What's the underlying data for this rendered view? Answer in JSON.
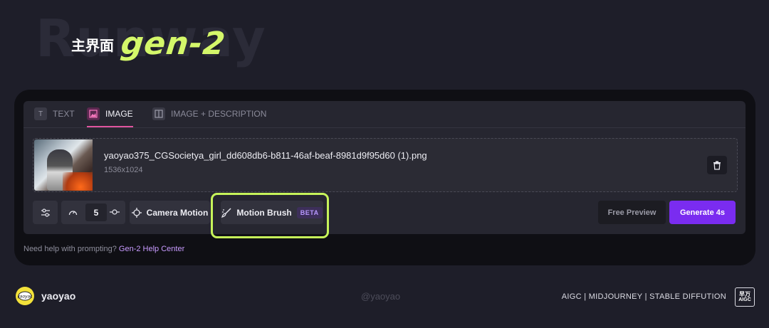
{
  "header": {
    "watermark": "Runway",
    "title_cn": "主界面",
    "title_gen": "gen-2"
  },
  "tabs": [
    {
      "label": "TEXT",
      "icon": "text-icon",
      "active": false
    },
    {
      "label": "IMAGE",
      "icon": "image-icon",
      "active": true
    },
    {
      "label": "IMAGE + DESCRIPTION",
      "icon": "image-description-icon",
      "active": false
    }
  ],
  "file": {
    "name": "yaoyao375_CGSocietya_girl_dd608db6-b811-46af-beaf-8981d9f95d60 (1).png",
    "dimensions": "1536x1024"
  },
  "toolbar": {
    "speed_value": "5",
    "camera_motion_label": "Camera Motion",
    "motion_brush_label": "Motion Brush",
    "beta_label": "BETA",
    "free_preview_label": "Free Preview",
    "generate_label": "Generate 4s"
  },
  "help": {
    "text": "Need help with prompting?",
    "link": "Gen-2 Help Center"
  },
  "footer": {
    "author": "yaoyao",
    "handle": "@yaoyao",
    "tags": "AIGC | MIDJOURNEY | STABLE DIFFUTION",
    "logo_line1": "早万",
    "logo_line2": "AIGC"
  },
  "colors": {
    "accent_highlight": "#c6f35a",
    "generate_button": "#7a2cf0",
    "active_tab": "#e0559f"
  }
}
